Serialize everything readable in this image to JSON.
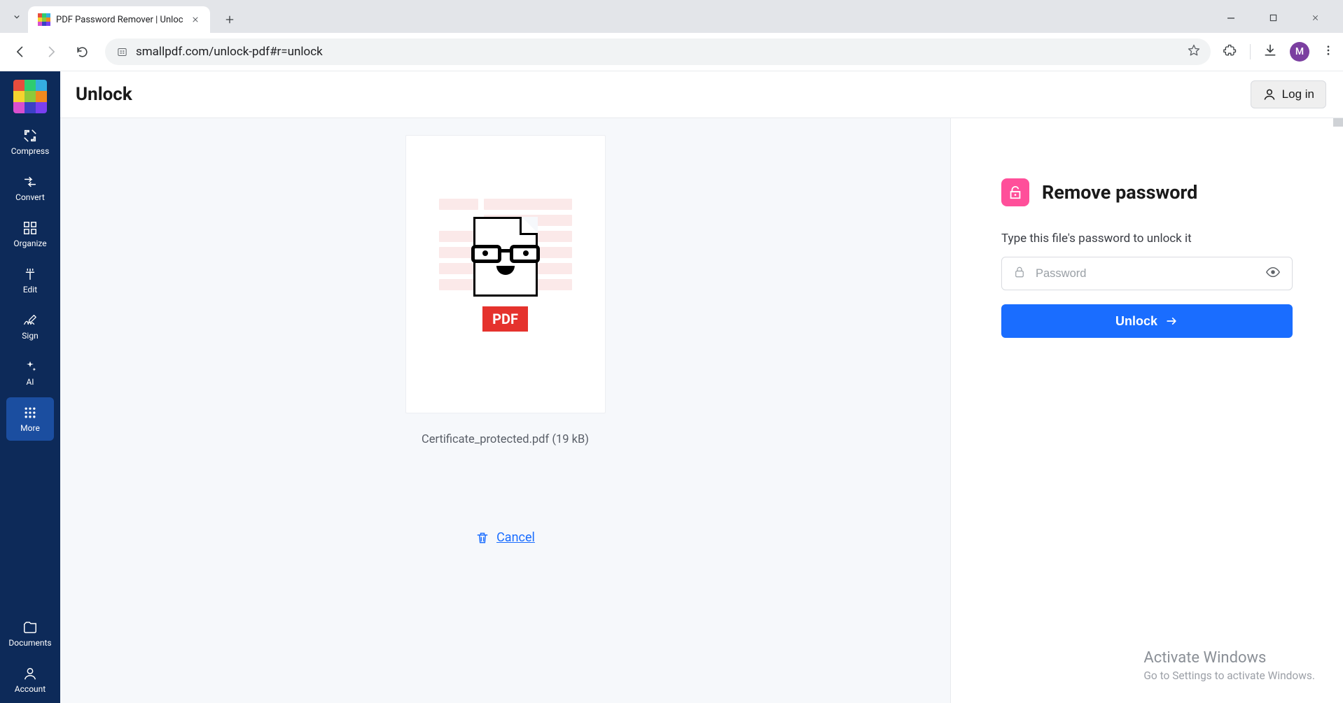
{
  "browser": {
    "tab_title": "PDF Password Remover | Unloc",
    "url": "smallpdf.com/unlock-pdf#r=unlock",
    "profile_initial": "M"
  },
  "sidebar": {
    "items": [
      {
        "label": "Compress"
      },
      {
        "label": "Convert"
      },
      {
        "label": "Organize"
      },
      {
        "label": "Edit"
      },
      {
        "label": "Sign"
      },
      {
        "label": "AI"
      },
      {
        "label": "More"
      },
      {
        "label": "Documents"
      },
      {
        "label": "Account"
      }
    ]
  },
  "header": {
    "page_title": "Unlock",
    "login_label": "Log in"
  },
  "file": {
    "badge": "PDF",
    "name_line": "Certificate_protected.pdf (19 kB)",
    "cancel_label": "Cancel"
  },
  "panel": {
    "title": "Remove password",
    "subtitle": "Type this file's password to unlock it",
    "password_placeholder": "Password",
    "button_label": "Unlock"
  },
  "watermark": {
    "line1": "Activate Windows",
    "line2": "Go to Settings to activate Windows."
  },
  "colors": {
    "sidebar_bg": "#0d2a59",
    "primary_blue": "#1a6dff",
    "pink": "#ff4f9a",
    "pdf_red": "#e5322d"
  }
}
